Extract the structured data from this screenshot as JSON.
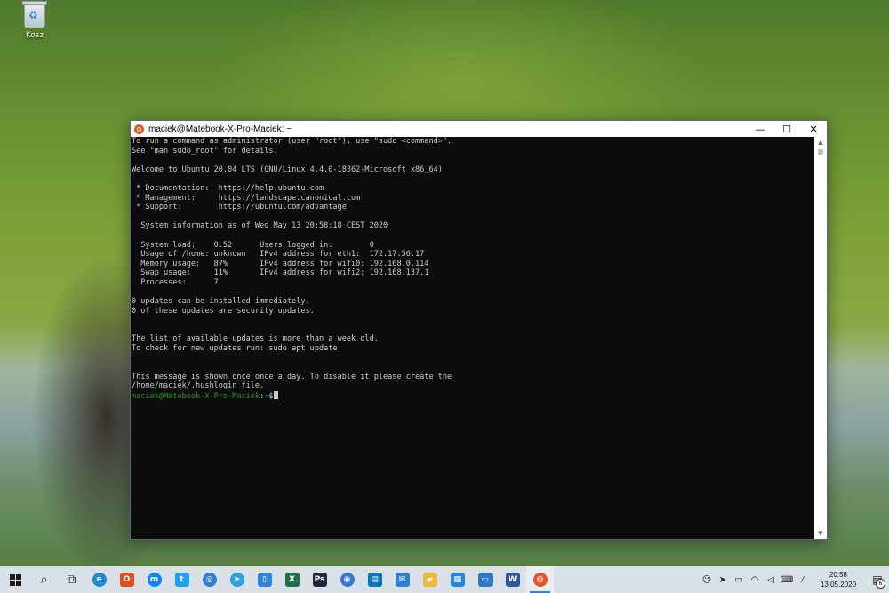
{
  "desktop": {
    "recycle_bin_label": "Kosz"
  },
  "window": {
    "title": "maciek@Matebook-X-Pro-Maciek: ~",
    "controls": {
      "minimize": "—",
      "maximize": "☐",
      "close": "✕"
    }
  },
  "terminal": {
    "output_lines": [
      "To run a command as administrator (user \"root\"), use \"sudo <command>\".",
      "See \"man sudo_root\" for details.",
      "",
      "Welcome to Ubuntu 20.04 LTS (GNU/Linux 4.4.0-18362-Microsoft x86_64)",
      "",
      " * Documentation:  https://help.ubuntu.com",
      " * Management:     https://landscape.canonical.com",
      " * Support:        https://ubuntu.com/advantage",
      "",
      "  System information as of Wed May 13 20:58:18 CEST 2020",
      "",
      "  System load:    0.52      Users logged in:        0",
      "  Usage of /home: unknown   IPv4 address for eth1:  172.17.56.17",
      "  Memory usage:   87%       IPv4 address for wifi0: 192.168.0.114",
      "  Swap usage:     11%       IPv4 address for wifi2: 192.168.137.1",
      "  Processes:      7",
      "",
      "0 updates can be installed immediately.",
      "0 of these updates are security updates.",
      "",
      "",
      "The list of available updates is more than a week old.",
      "To check for new updates run: sudo apt update",
      "",
      "",
      "This message is shown once once a day. To disable it please create the",
      "/home/maciek/.hushlogin file."
    ],
    "prompt": {
      "user_host": "maciek@Matebook-X-Pro-Maciek",
      "separator": ":",
      "path": "~",
      "symbol": "$"
    }
  },
  "taskbar": {
    "apps": [
      {
        "id": "search",
        "glyph": "⌕",
        "color": "#1a1a1a",
        "icon": "search-icon"
      },
      {
        "id": "task-view",
        "glyph": "⧉",
        "color": "#1a1a1a",
        "icon": "task-view-icon"
      },
      {
        "id": "edge",
        "glyph": "e",
        "color": "#1b8ad8",
        "icon": "edge-icon"
      },
      {
        "id": "office",
        "glyph": "O",
        "color": "#e74c1c",
        "icon": "office-icon"
      },
      {
        "id": "messenger",
        "glyph": "m",
        "color": "#0a84ff",
        "icon": "messenger-icon"
      },
      {
        "id": "twitter",
        "glyph": "t",
        "color": "#1da1f2",
        "icon": "twitter-icon"
      },
      {
        "id": "instagram",
        "glyph": "◎",
        "color": "#2f7fd6",
        "icon": "instagram-icon"
      },
      {
        "id": "telegram",
        "glyph": "➤",
        "color": "#2aa3df",
        "icon": "telegram-icon"
      },
      {
        "id": "phone",
        "glyph": "▯",
        "color": "#2f86d8",
        "icon": "phone-icon"
      },
      {
        "id": "excel",
        "glyph": "X",
        "color": "#1e7145",
        "icon": "excel-icon"
      },
      {
        "id": "photoshop",
        "glyph": "Ps",
        "color": "#1c2a3a",
        "icon": "photoshop-icon"
      },
      {
        "id": "chrome",
        "glyph": "◉",
        "color": "#3478d4",
        "icon": "chrome-icon"
      },
      {
        "id": "trello",
        "glyph": "▤",
        "color": "#0079bf",
        "icon": "trello-icon"
      },
      {
        "id": "mail",
        "glyph": "✉",
        "color": "#2f7fd6",
        "icon": "mail-icon"
      },
      {
        "id": "explorer",
        "glyph": "▰",
        "color": "#e9b93a",
        "icon": "folder-icon"
      },
      {
        "id": "azure",
        "glyph": "▦",
        "color": "#1f8be0",
        "icon": "azure-icon"
      },
      {
        "id": "remote",
        "glyph": "▭",
        "color": "#2e78c7",
        "icon": "remote-desktop-icon"
      },
      {
        "id": "word",
        "glyph": "W",
        "color": "#2b579a",
        "icon": "word-icon"
      },
      {
        "id": "ubuntu",
        "glyph": "◍",
        "color": "#e95420",
        "icon": "ubuntu-icon",
        "active": true
      }
    ],
    "tray": [
      {
        "id": "people",
        "glyph": "☺",
        "icon": "people-icon"
      },
      {
        "id": "tray-telegram",
        "glyph": "➤",
        "icon": "telegram-tray-icon"
      },
      {
        "id": "battery",
        "glyph": "▭",
        "icon": "battery-icon"
      },
      {
        "id": "wifi",
        "glyph": "◠",
        "icon": "wifi-icon"
      },
      {
        "id": "volume",
        "glyph": "◁",
        "icon": "volume-icon"
      },
      {
        "id": "keyboard",
        "glyph": "⌨",
        "icon": "keyboard-icon"
      },
      {
        "id": "ime",
        "glyph": "⁄",
        "icon": "pen-icon"
      }
    ],
    "clock": {
      "time": "20:58",
      "date": "13.05.2020"
    },
    "notifications_count": "6"
  }
}
